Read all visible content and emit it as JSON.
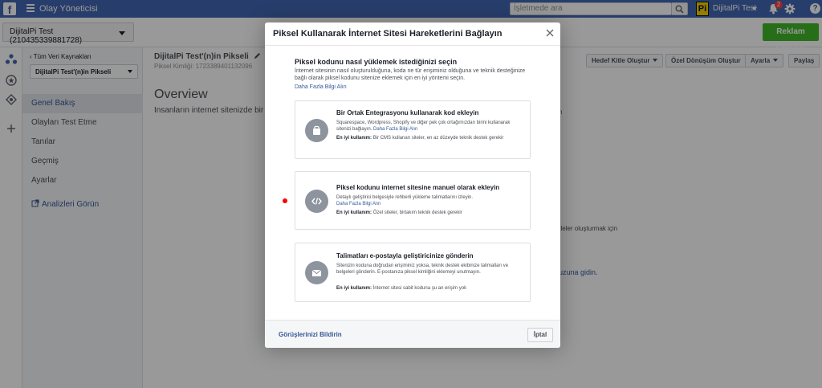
{
  "topbar": {
    "fb_logo": "f",
    "app_title": "Olay Yöneticisi",
    "search_placeholder": "İşletmede ara",
    "brand_logo": "Pi",
    "business_name": "DijitalPi Test",
    "notification_count": "2",
    "help": "?",
    "icons": [
      "menu-icon",
      "search-icon",
      "bell-icon",
      "gear-icon",
      "help-icon"
    ]
  },
  "account_bar": {
    "account": "DijitalPi Test (210435339881728)",
    "create_ad": "Reklam Oluştur"
  },
  "sidebar": {
    "back": "Tüm Veri Kaynakları",
    "pixel_select": "DijitalPi Test'(n)in Pikseli",
    "items": [
      {
        "label": "Genel Bakış",
        "active": true
      },
      {
        "label": "Olayları Test Etme",
        "active": false
      },
      {
        "label": "Tanılar",
        "active": false
      },
      {
        "label": "Geçmiş",
        "active": false
      },
      {
        "label": "Ayarlar",
        "active": false
      }
    ],
    "analytics": "Analizleri Görün"
  },
  "main": {
    "pixel_title": "DijitalPi Test'(n)in Pikseli",
    "pixel_id": "Piksel Kimliği: 1723389401132096",
    "overview": "Overview",
    "description": "İnsanların internet sitenizde bir düğm",
    "toolbar": {
      "audience": "Hedef Kitle Oluştur",
      "conversion": "Özel Dönüşüm Oluştur",
      "settings": "Ayarla",
      "share": "Paylaş"
    },
    "bg_fragment_1": "f kitleler oluşturmak için",
    "bg_fragment_2": "uzuna gidin.",
    "bg_fragment_3": "n"
  },
  "modal": {
    "title": "Piksel Kullanarak İnternet Sitesi Hareketlerini Bağlayın",
    "question": "Piksel kodunu nasıl yüklemek istediğinizi seçin",
    "intro": "İnternet sitesinin nasıl oluşturulduğuna, koda ne tür erişiminiz olduğuna ve teknik desteğinize bağlı olarak piksel kodunu sitenize eklemek için en iyi yöntemi seçin.",
    "learn_more": "Daha Fazla Bilgi Alın",
    "options": [
      {
        "icon": "shopping-bag-icon",
        "title": "Bir Ortak Entegrasyonu kullanarak kod ekleyin",
        "text": "Squarespace, Wordpress, Shopify ve diğer pek çok ortağımızdan birini kullanarak sitenizi bağlayın.",
        "link": "Daha Fazla Bilgi Alın",
        "best_label": "En iyi kullanım:",
        "best_text": "Bir CMS kullanan siteler, en az düzeyde teknik destek gerekir"
      },
      {
        "icon": "code-icon",
        "title": "Piksel kodunu internet sitesine manuel olarak ekleyin",
        "text": "Detaylı geliştirici belgesiyle rehberli yükleme talimatlarını izleyin.",
        "link": "Daha Fazla Bilgi Alın",
        "best_label": "En iyi kullanım:",
        "best_text": "Özel siteler, birtakım teknik destek gerekir"
      },
      {
        "icon": "envelope-icon",
        "title": "Talimatları e-postayla geliştiricinize gönderin",
        "text": "Sitenizin koduna doğrudan erişiminiz yoksa, teknik destek ekibinize talimatları ve belgeleri gönderin. E-postanıza piksel kimliğini eklemeyi unutmayın.",
        "link": "",
        "best_label": "En iyi kullanım:",
        "best_text": "İnternet sitesi sabit koduna şu an erişim yok"
      }
    ],
    "feedback": "Görüşlerinizi Bildirin",
    "cancel": "İptal"
  },
  "colors": {
    "topbar": "#4267b2",
    "create_ad": "#42b72a",
    "link": "#365899",
    "icon_circle": "#8d949e",
    "indicator": "#ff0000"
  }
}
